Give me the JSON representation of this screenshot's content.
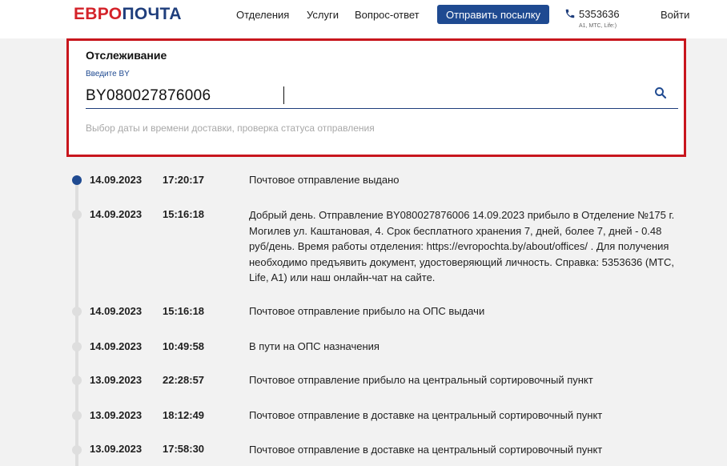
{
  "header": {
    "logo_part1": "ЕВРО",
    "logo_part2": "ПОЧТА",
    "nav": [
      "Отделения",
      "Услуги",
      "Вопрос-ответ"
    ],
    "send_button": "Отправить посылку",
    "phone": "5353636",
    "phone_operators": "A1, МТС, Life:)",
    "login": "Войти"
  },
  "tracking": {
    "title": "Отслеживание",
    "label": "Введите BY",
    "value": "BY080027876006",
    "hint": "Выбор даты и времени доставки, проверка статуса отправления"
  },
  "events": [
    {
      "date": "14.09.2023",
      "time": "17:20:17",
      "text": "Почтовое отправление выдано",
      "active": true
    },
    {
      "date": "14.09.2023",
      "time": "15:16:18",
      "text": "Добрый день. Отправление BY080027876006 14.09.2023 прибыло в Отделение №175 г. Могилев ул. Каштановая, 4. Срок бесплатного хранения 7, дней, более 7, дней - 0.48 руб/день. Время работы отделения: https://evropochta.by/about/offices/ . Для получения необходимо предъявить документ, удостоверяющий личность. Справка: 5353636 (МТС, Life, A1) или наш онлайн-чат на сайте.",
      "active": false
    },
    {
      "date": "14.09.2023",
      "time": "15:16:18",
      "text": "Почтовое отправление прибыло на ОПС выдачи",
      "active": false
    },
    {
      "date": "14.09.2023",
      "time": "10:49:58",
      "text": "В пути на ОПС назначения",
      "active": false
    },
    {
      "date": "13.09.2023",
      "time": "22:28:57",
      "text": "Почтовое отправление прибыло на центральный сортировочный пункт",
      "active": false
    },
    {
      "date": "13.09.2023",
      "time": "18:12:49",
      "text": "Почтовое отправление в доставке на центральный сортировочный пункт",
      "active": false
    },
    {
      "date": "13.09.2023",
      "time": "17:58:30",
      "text": "Почтовое отправление в доставке на центральный сортировочный пункт",
      "active": false
    }
  ],
  "colors": {
    "brand_red": "#d42229",
    "brand_blue": "#1f4a91",
    "highlight_border": "#c8161d",
    "timeline_inactive": "#dedede"
  }
}
